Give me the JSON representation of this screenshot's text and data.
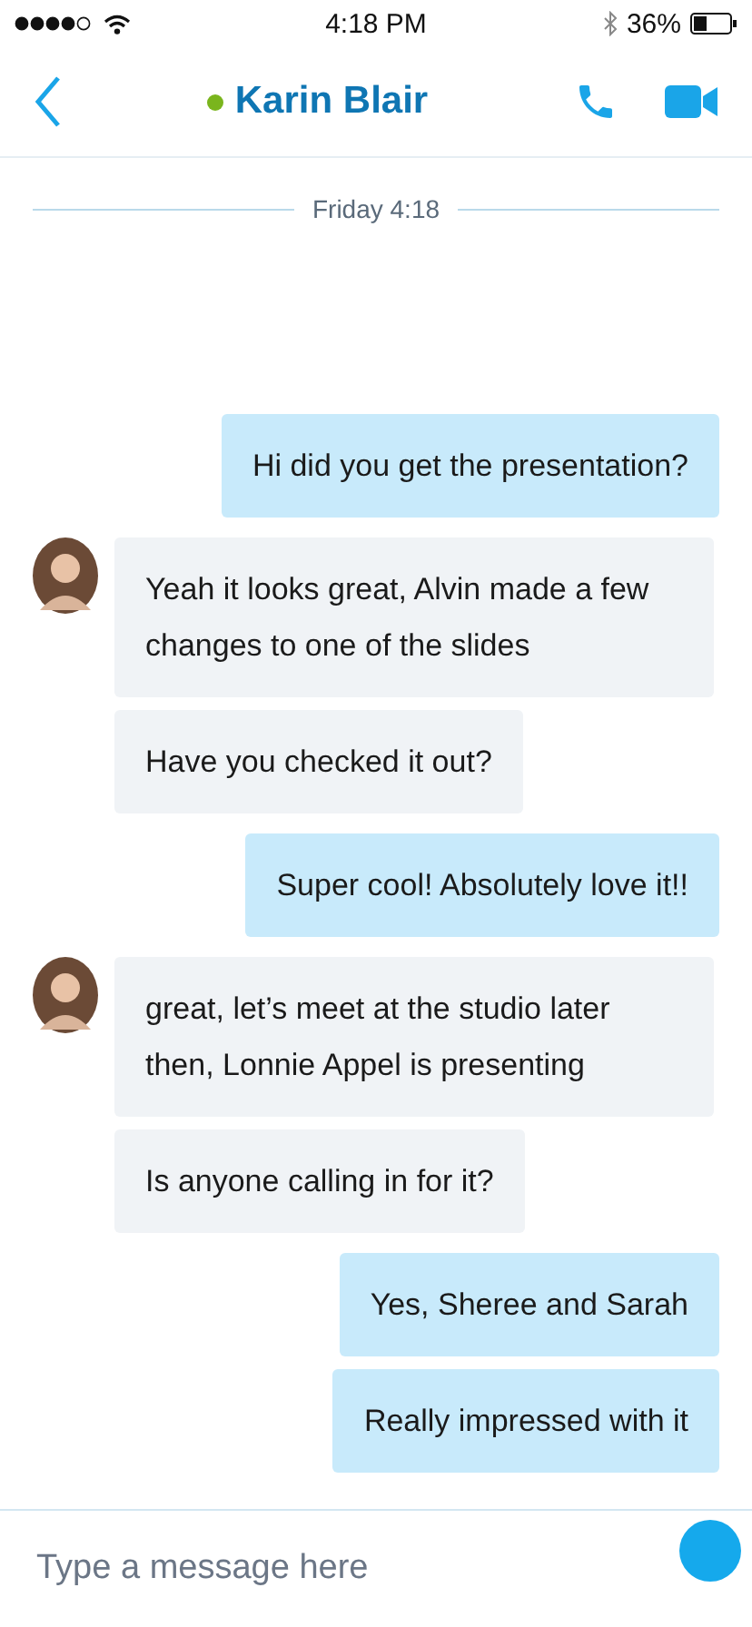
{
  "status_bar": {
    "time": "4:18 PM",
    "battery": "36%"
  },
  "header": {
    "contact": "Karin Blair",
    "online": true
  },
  "date_divider": "Friday 4:18",
  "groups": [
    {
      "kind": "outgoing",
      "messages": [
        "Hi did you get the presentation?"
      ]
    },
    {
      "kind": "incoming",
      "messages": [
        "Yeah it looks great, Alvin made a few changes to one of the slides",
        "Have you checked it out?"
      ]
    },
    {
      "kind": "outgoing",
      "messages": [
        "Super cool! Absolutely love it!!"
      ]
    },
    {
      "kind": "incoming",
      "messages": [
        "great, let’s meet at the studio later then, Lonnie Appel is presenting",
        "Is anyone calling in for it?"
      ]
    },
    {
      "kind": "outgoing",
      "messages": [
        "Yes, Sheree and Sarah",
        "Really impressed with it"
      ]
    }
  ],
  "composer": {
    "placeholder": "Type a message here"
  }
}
